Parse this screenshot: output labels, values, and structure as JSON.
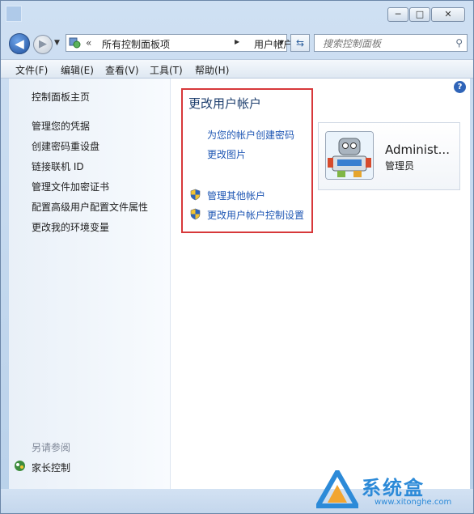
{
  "window": {
    "controls": {
      "minimize": "─",
      "maximize": "□",
      "close": "✕"
    }
  },
  "nav": {
    "back_icon": "back-arrow-icon",
    "forward_icon": "forward-arrow-icon",
    "address": {
      "overflow": "«",
      "crumbs": [
        "所有控制面板项",
        "用户帐户"
      ]
    },
    "search_placeholder": "搜索控制面板"
  },
  "menu": [
    "文件(F)",
    "编辑(E)",
    "查看(V)",
    "工具(T)",
    "帮助(H)"
  ],
  "sidebar": {
    "home": "控制面板主页",
    "items": [
      "管理您的凭据",
      "创建密码重设盘",
      "链接联机 ID",
      "管理文件加密证书",
      "配置高级用户配置文件属性",
      "更改我的环境变量"
    ],
    "see_also_title": "另请参阅",
    "see_also_items": [
      "家长控制"
    ]
  },
  "main": {
    "title": "更改用户帐户",
    "tasks": [
      "为您的帐户创建密码",
      "更改图片"
    ],
    "admin_tasks": [
      "管理其他帐户",
      "更改用户帐户控制设置"
    ]
  },
  "user": {
    "name": "Administ...",
    "role": "管理员"
  },
  "help": {
    "label": "?"
  },
  "watermark": {
    "title": "系统盒",
    "url": "www.xitonghe.com"
  },
  "colors": {
    "link": "#1f57b4",
    "highlight_box": "#d7383a",
    "title": "#1e3f6e"
  }
}
